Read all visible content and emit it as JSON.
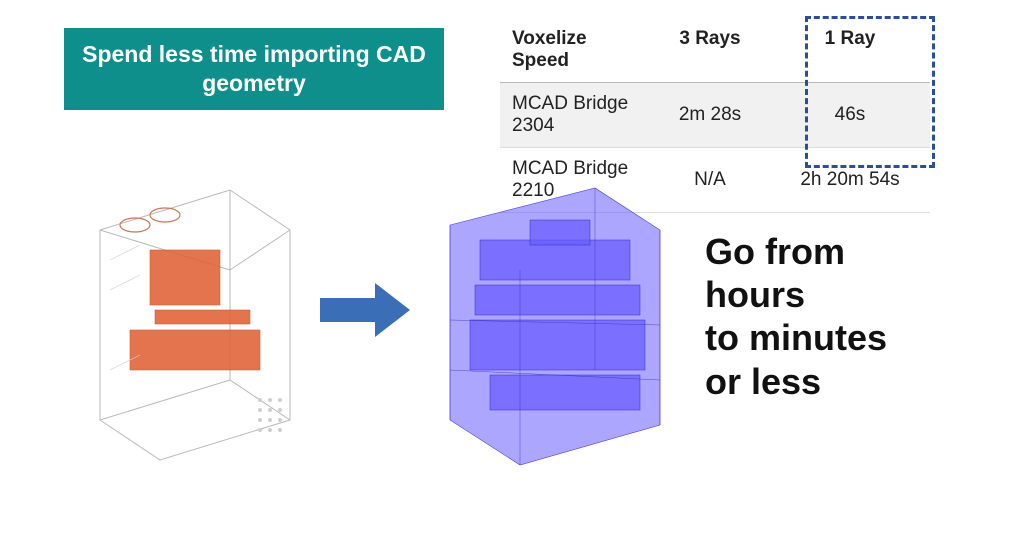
{
  "banner": {
    "title": "Spend less time importing CAD geometry"
  },
  "table": {
    "headers": [
      "Voxelize Speed",
      "3 Rays",
      "1 Ray"
    ],
    "rows": [
      {
        "label": "MCAD Bridge 2304",
        "rays3": "2m 28s",
        "ray1": "46s"
      },
      {
        "label": "MCAD Bridge 2210",
        "rays3": "N/A",
        "ray1": "2h 20m 54s"
      }
    ]
  },
  "tagline": "Go from\nhours\nto minutes\nor less",
  "icons": {
    "arrow": "arrow-right",
    "cad_input": "cad-wireframe-model",
    "cad_output": "cad-voxelized-model"
  },
  "colors": {
    "banner_bg": "#0e8f8b",
    "arrow": "#3a6fb7",
    "voxel": "#6a5cff",
    "highlight": "#2a4e9c"
  }
}
